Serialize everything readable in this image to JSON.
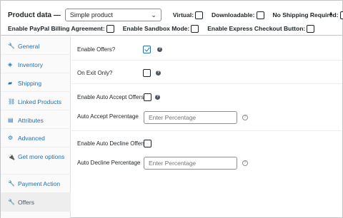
{
  "header": {
    "title": "Product data —",
    "product_type": "Simple product",
    "options": [
      {
        "label": "Virtual:"
      },
      {
        "label": "Downloadable:"
      },
      {
        "label": "No Shipping Required:"
      }
    ],
    "options_row2": [
      {
        "label": "Enable PayPal Billing Agreement:"
      },
      {
        "label": "Enable Sandbox Mode:"
      },
      {
        "label": "Enable Express Checkout Button:"
      }
    ]
  },
  "sidebar": {
    "items": [
      {
        "label": "General",
        "icon": "wrench-icon"
      },
      {
        "label": "Inventory",
        "icon": "tag-icon"
      },
      {
        "label": "Shipping",
        "icon": "truck-icon"
      },
      {
        "label": "Linked Products",
        "icon": "link-icon"
      },
      {
        "label": "Attributes",
        "icon": "list-icon"
      },
      {
        "label": "Advanced",
        "icon": "gear-icon"
      },
      {
        "label": "Get more options",
        "icon": "plugin-icon"
      },
      {
        "label": "Payment Action",
        "icon": "wrench-icon"
      },
      {
        "label": "Offers",
        "icon": "wrench-icon"
      }
    ]
  },
  "main": {
    "enable_offers": {
      "label": "Enable Offers?",
      "checked": true
    },
    "on_exit_only": {
      "label": "On Exit Only?",
      "checked": false
    },
    "auto_accept": {
      "label": "Enable Auto Accept Offers?",
      "checked": false
    },
    "auto_accept_pct": {
      "label": "Auto Accept Percentage",
      "placeholder": "Enter Percentage"
    },
    "auto_decline": {
      "label": "Enable Auto Decline Offers?",
      "checked": false
    },
    "auto_decline_pct": {
      "label": "Auto Decline Percentage",
      "placeholder": "Enter Percentage"
    }
  },
  "colors": {
    "accent": "#2271b1",
    "text": "#1d2327",
    "border": "#c3c4c7"
  }
}
